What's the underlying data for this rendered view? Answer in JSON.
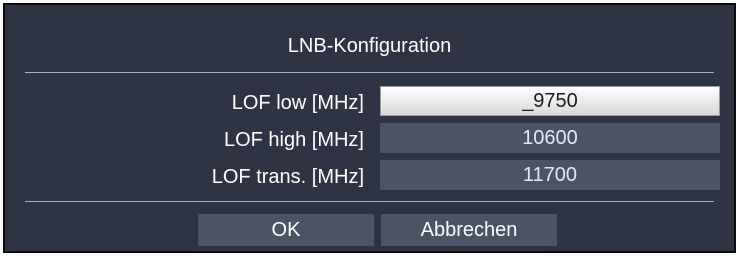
{
  "dialog": {
    "title": "LNB-Konfiguration",
    "rows": [
      {
        "label": "LOF low [MHz]",
        "value": "_9750",
        "focused": true
      },
      {
        "label": "LOF high [MHz]",
        "value": "10600",
        "focused": false
      },
      {
        "label": "LOF trans. [MHz]",
        "value": "11700",
        "focused": false
      }
    ],
    "buttons": {
      "ok": "OK",
      "cancel": "Abbrechen"
    }
  },
  "colors": {
    "dialog_bg": "#2e3444",
    "field_bg": "#4b5366",
    "focus_bg": "#f2f2f2"
  }
}
